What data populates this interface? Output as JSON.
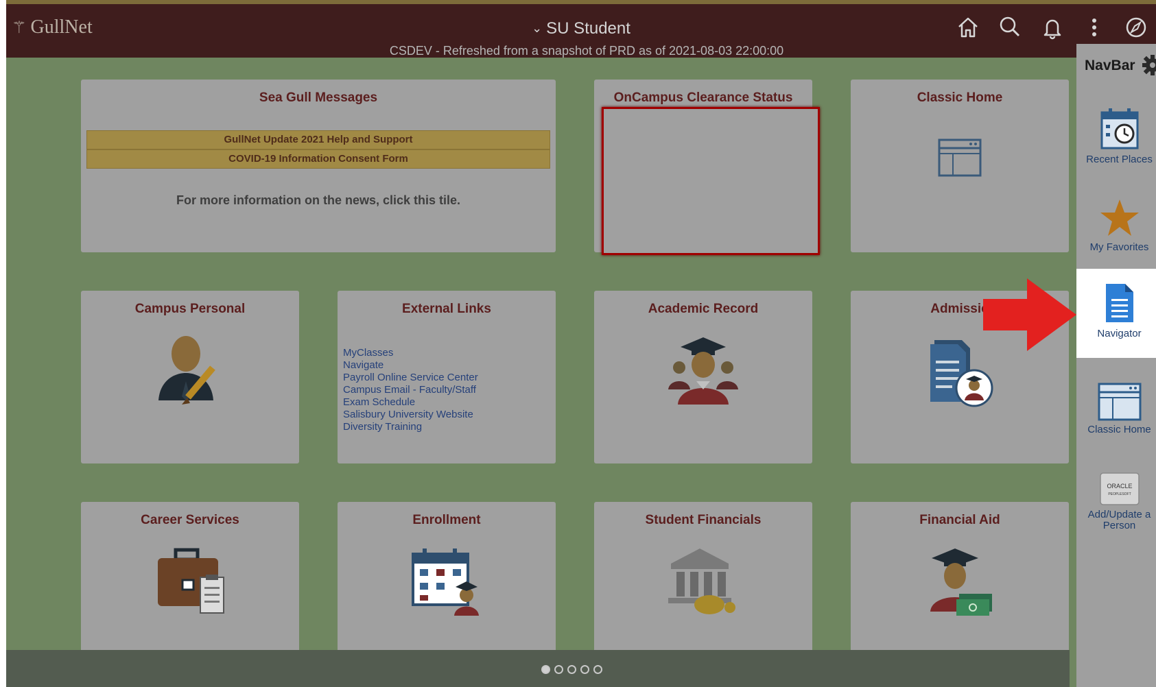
{
  "header": {
    "logo_text": "GullNet",
    "title": "SU Student",
    "subtitle": "CSDEV - Refreshed from a snapshot of PRD as of 2021-08-03 22:00:00",
    "icons": [
      "home-icon",
      "search-icon",
      "bell-icon",
      "kebab-menu-icon",
      "navbar-compass-icon"
    ],
    "colors": {
      "header_bg": "#3f1d1d",
      "page_bg": "#6f8660",
      "tile_bg": "#a0a0a0",
      "accent_red": "#a00000"
    }
  },
  "tiles": {
    "sea_gull": {
      "title": "Sea Gull Messages",
      "messages": [
        "GullNet Update 2021 Help and Support",
        "COVID-19 Information Consent Form"
      ],
      "info": "For more information on the news, click this tile."
    },
    "clearance": {
      "title": "OnCampus Clearance Status"
    },
    "classic_home": {
      "title": "Classic Home"
    },
    "campus_personal": {
      "title": "Campus Personal"
    },
    "external_links": {
      "title": "External Links",
      "links": [
        "MyClasses",
        "Navigate",
        "Payroll Online Service Center",
        "Campus Email - Faculty/Staff",
        "Exam Schedule",
        "Salisbury University Website",
        "Diversity Training"
      ]
    },
    "academic_record": {
      "title": "Academic Record"
    },
    "admissions": {
      "title": "Admissio"
    },
    "career_services": {
      "title": "Career Services"
    },
    "enrollment": {
      "title": "Enrollment"
    },
    "student_financials": {
      "title": "Student Financials"
    },
    "financial_aid": {
      "title": "Financial Aid"
    }
  },
  "pagination": {
    "pages": 5,
    "current": 1
  },
  "navbar": {
    "title": "NavBar",
    "items": [
      {
        "label": "Recent Places"
      },
      {
        "label": "My Favorites"
      },
      {
        "label": "Navigator"
      },
      {
        "label": "Classic Home"
      },
      {
        "label_line1": "Add/Update a",
        "label_line2": "Person",
        "logo_line1": "ORACLE",
        "logo_line2": "PEOPLESOFT"
      }
    ]
  }
}
